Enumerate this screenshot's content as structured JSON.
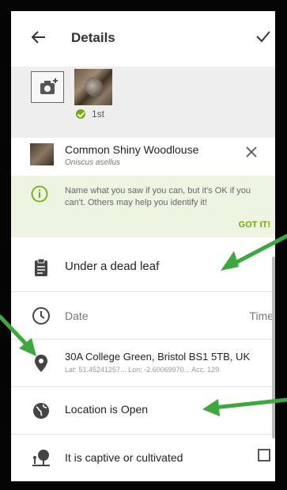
{
  "header": {
    "back_icon": "arrow-left-icon",
    "title": "Details",
    "confirm_icon": "check-icon"
  },
  "photos": {
    "add_icon": "add-photo-icon",
    "first_label": "1st"
  },
  "taxon": {
    "common_name": "Common Shiny Woodlouse",
    "scientific_name": "Oniscus asellus",
    "clear_icon": "close-icon"
  },
  "tip": {
    "text": "Name what you saw if you can, but it's OK if you can't. Others may help you identify it!",
    "action": "GOT IT!"
  },
  "notes": {
    "value": "Under a dead leaf"
  },
  "datetime": {
    "date_label": "Date",
    "time_label": "Time"
  },
  "location": {
    "name": "30A College Green, Bristol BS1 5TB, UK",
    "meta": "Lat: 51.45241257...  Lon: -2.60069970...  Acc. 129"
  },
  "geoprivacy": {
    "label": "Location is Open"
  },
  "captive": {
    "label": "It is captive or cultivated"
  },
  "colors": {
    "accent": "#74ac00",
    "annotation_arrow": "#3da83d",
    "tip_background": "#eef4e2"
  }
}
